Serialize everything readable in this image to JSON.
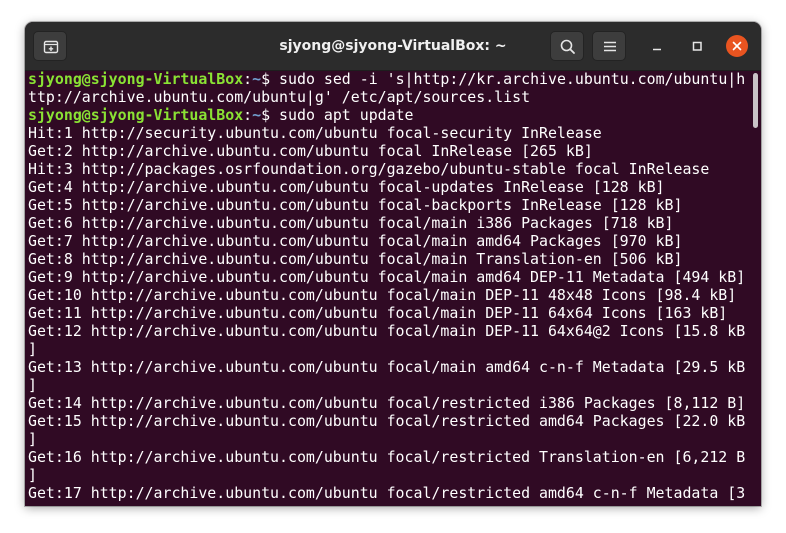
{
  "window": {
    "title": "sjyong@sjyong-VirtualBox: ~"
  },
  "toolbar": {
    "new_tab_icon": "new-tab-icon",
    "search_icon": "search-icon",
    "menu_icon": "hamburger-menu-icon",
    "minimize_icon": "minimize-icon",
    "maximize_icon": "maximize-icon",
    "close_icon": "close-icon"
  },
  "colors": {
    "terminal_bg": "#300a24",
    "prompt_user": "#8ae234",
    "prompt_path": "#729fcf",
    "close_button": "#e95420"
  },
  "terminal": {
    "prompt": {
      "user_host": "sjyong@sjyong-VirtualBox",
      "sep": ":",
      "path": "~",
      "symbol": "$ "
    },
    "commands": [
      "sudo sed -i 's|http://kr.archive.ubuntu.com/ubuntu|h",
      "sudo apt update"
    ],
    "lines": [
      "ttp://archive.ubuntu.com/ubuntu|g' /etc/apt/sources.list",
      "Hit:1 http://security.ubuntu.com/ubuntu focal-security InRelease",
      "Get:2 http://archive.ubuntu.com/ubuntu focal InRelease [265 kB]",
      "Hit:3 http://packages.osrfoundation.org/gazebo/ubuntu-stable focal InRelease",
      "Get:4 http://archive.ubuntu.com/ubuntu focal-updates InRelease [128 kB]",
      "Get:5 http://archive.ubuntu.com/ubuntu focal-backports InRelease [128 kB]",
      "Get:6 http://archive.ubuntu.com/ubuntu focal/main i386 Packages [718 kB]",
      "Get:7 http://archive.ubuntu.com/ubuntu focal/main amd64 Packages [970 kB]",
      "Get:8 http://archive.ubuntu.com/ubuntu focal/main Translation-en [506 kB]",
      "Get:9 http://archive.ubuntu.com/ubuntu focal/main amd64 DEP-11 Metadata [494 kB]",
      "Get:10 http://archive.ubuntu.com/ubuntu focal/main DEP-11 48x48 Icons [98.4 kB]",
      "Get:11 http://archive.ubuntu.com/ubuntu focal/main DEP-11 64x64 Icons [163 kB]",
      "Get:12 http://archive.ubuntu.com/ubuntu focal/main DEP-11 64x64@2 Icons [15.8 kB",
      "]",
      "Get:13 http://archive.ubuntu.com/ubuntu focal/main amd64 c-n-f Metadata [29.5 kB",
      "]",
      "Get:14 http://archive.ubuntu.com/ubuntu focal/restricted i386 Packages [8,112 B]",
      "Get:15 http://archive.ubuntu.com/ubuntu focal/restricted amd64 Packages [22.0 kB",
      "]",
      "Get:16 http://archive.ubuntu.com/ubuntu focal/restricted Translation-en [6,212 B",
      "]",
      "Get:17 http://archive.ubuntu.com/ubuntu focal/restricted amd64 c-n-f Metadata [3"
    ]
  }
}
